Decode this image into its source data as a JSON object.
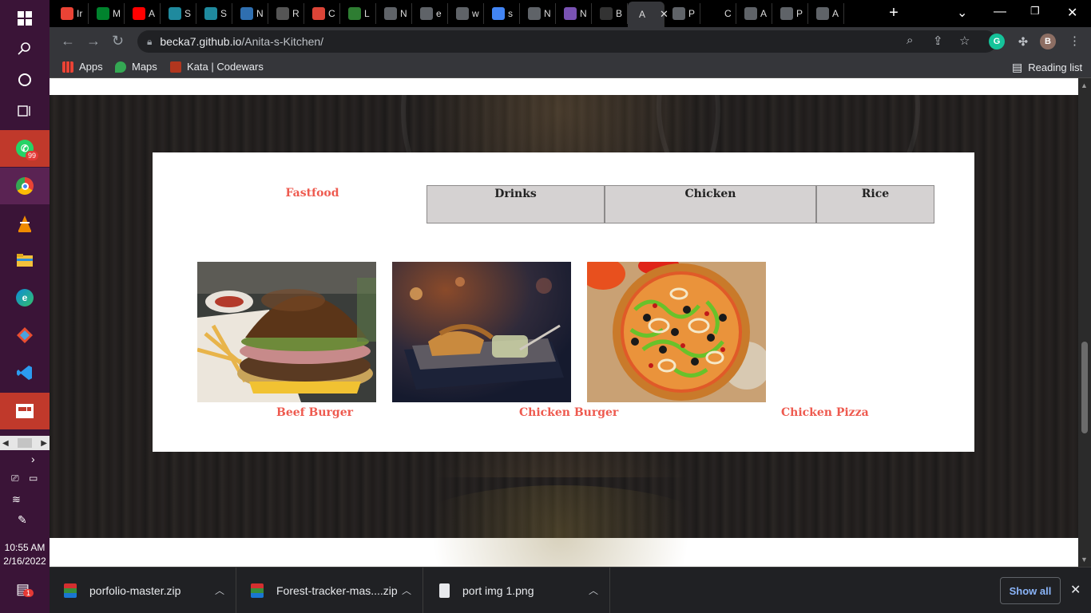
{
  "taskbar": {
    "whatsapp_badge": "99",
    "clock_time": "10:55 AM",
    "clock_date": "2/16/2022",
    "notification_count": "1"
  },
  "tabs": [
    {
      "letter": "Ir",
      "icon": "gmail-icon",
      "color": "#ea4335"
    },
    {
      "letter": "M",
      "icon": "meet-icon",
      "color": "#00832d"
    },
    {
      "letter": "A",
      "icon": "youtube-icon",
      "color": "#ff0000"
    },
    {
      "letter": "S",
      "icon": "app-icon",
      "color": "#1f8a9e"
    },
    {
      "letter": "S",
      "icon": "app-icon",
      "color": "#1f8a9e"
    },
    {
      "letter": "N",
      "icon": "app-icon",
      "color": "#2f6fb0"
    },
    {
      "letter": "R",
      "icon": "app-icon",
      "color": "#555555"
    },
    {
      "letter": "C",
      "icon": "chrome-icon",
      "color": "#db4437"
    },
    {
      "letter": "L",
      "icon": "app-icon",
      "color": "#2e7d32"
    },
    {
      "letter": "N",
      "icon": "globe-icon",
      "color": "#5f6368"
    },
    {
      "letter": "e",
      "icon": "globe-icon",
      "color": "#5f6368"
    },
    {
      "letter": "w",
      "icon": "globe-icon",
      "color": "#5f6368"
    },
    {
      "letter": "s",
      "icon": "google-icon",
      "color": "#4285f4"
    },
    {
      "letter": "N",
      "icon": "globe-icon",
      "color": "#5f6368"
    },
    {
      "letter": "N",
      "icon": "bootstrap-icon",
      "color": "#7952b3"
    },
    {
      "letter": "B",
      "icon": "github-icon",
      "color": "#333333"
    },
    {
      "letter": "A",
      "icon": "app-icon",
      "color": "#000000",
      "active": true
    },
    {
      "letter": "P",
      "icon": "globe-icon",
      "color": "#5f6368"
    },
    {
      "letter": "C",
      "icon": "app-icon",
      "color": "#000000"
    },
    {
      "letter": "A",
      "icon": "globe-icon",
      "color": "#5f6368"
    },
    {
      "letter": "P",
      "icon": "globe-icon",
      "color": "#5f6368"
    },
    {
      "letter": "A",
      "icon": "globe-icon",
      "color": "#5f6368"
    }
  ],
  "address_bar": {
    "host": "becka7.github.io",
    "path": "/Anita-s-Kitchen/"
  },
  "profile_initial": "B",
  "bookmarks": {
    "apps": "Apps",
    "maps": "Maps",
    "codewars": "Kata | Codewars",
    "reading_list": "Reading list"
  },
  "menu": {
    "tabs": [
      "Fastfood",
      "Drinks",
      "Chicken",
      "Rice"
    ],
    "items": [
      "Beef Burger",
      "Chicken Burger",
      "Chicken Pizza"
    ]
  },
  "downloads": [
    {
      "name": "porfolio-master.zip"
    },
    {
      "name": "Forest-tracker-mas....zip"
    },
    {
      "name": "port img 1.png"
    }
  ],
  "show_all": "Show all",
  "colors": {
    "accent": "#ee5a4f",
    "tab_inactive_bg": "#d5d2d2"
  }
}
